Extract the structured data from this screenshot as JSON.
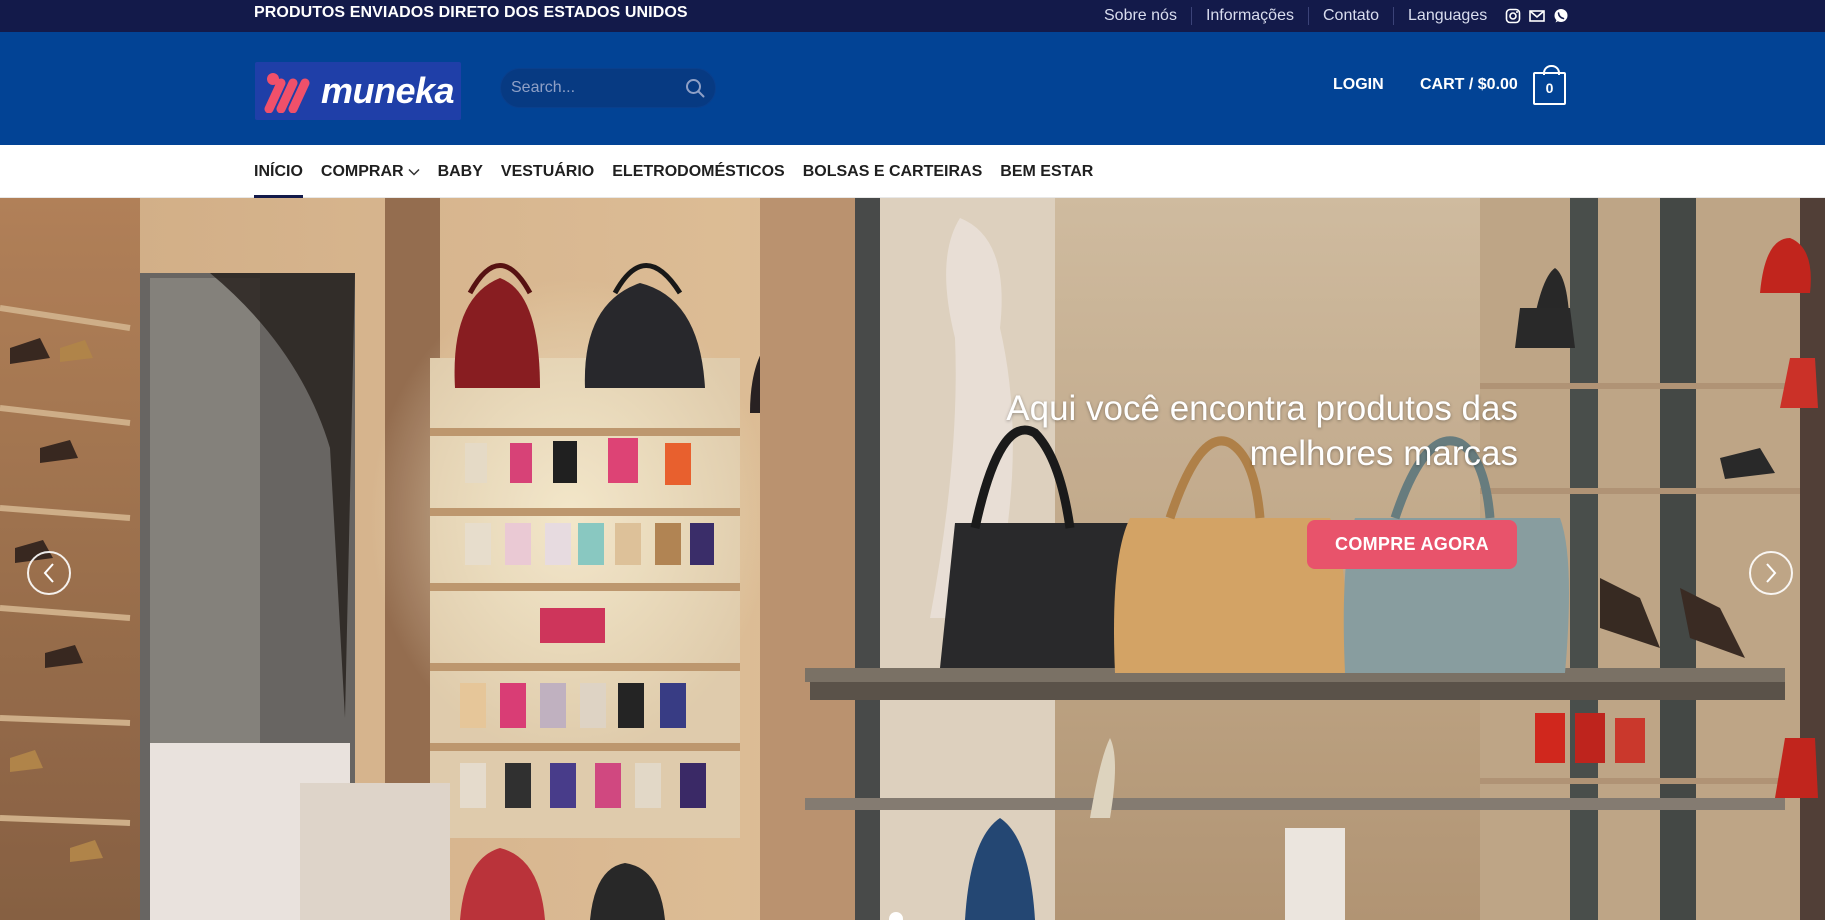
{
  "topbar": {
    "promo": "PRODUTOS ENVIADOS DIRETO DOS ESTADOS UNIDOS",
    "links": [
      "Sobre nós",
      "Informações",
      "Contato",
      "Languages"
    ],
    "social_icons": [
      "instagram-icon",
      "email-icon",
      "whatsapp-icon"
    ]
  },
  "header": {
    "logo_text": "muneka",
    "search_placeholder": "Search...",
    "login": "LOGIN",
    "cart": "CART / $0.00",
    "cart_count": "0"
  },
  "nav": {
    "items": [
      "INÍCIO",
      "COMPRAR",
      "BABY",
      "VESTUÁRIO",
      "ELETRODOMÉSTICOS",
      "BOLSAS E CARTEIRAS",
      "BEM ESTAR"
    ],
    "active": "INÍCIO"
  },
  "hero": {
    "headline_line1": "Aqui você encontra produtos das",
    "headline_line2": "melhores marcas",
    "cta": "COMPRE AGORA"
  },
  "colors": {
    "topbar": "#131a4a",
    "header": "#024395",
    "cta": "#e8536b"
  }
}
